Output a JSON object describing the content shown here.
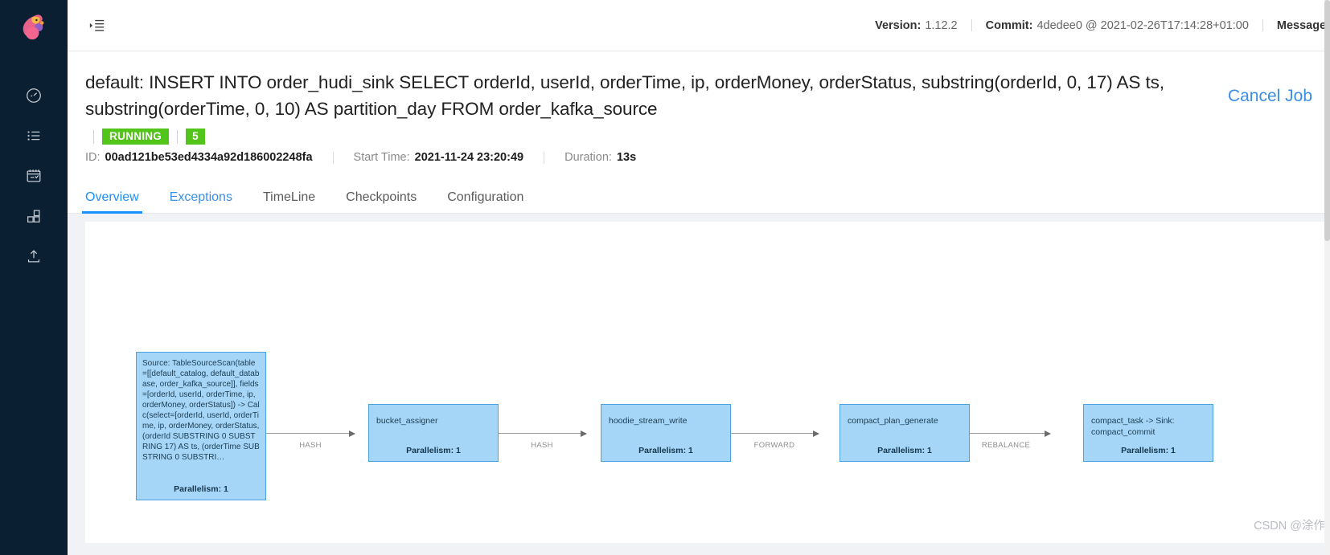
{
  "sidebar": {
    "logo_alt": "apache-flink-squirrel-logo",
    "items": [
      {
        "name": "overview",
        "icon": "dashboard-gauge-icon"
      },
      {
        "name": "jobs",
        "icon": "list-icon"
      },
      {
        "name": "task-managers",
        "icon": "calendar-check-icon"
      },
      {
        "name": "job-manager",
        "icon": "blocks-icon"
      },
      {
        "name": "submit-new-job",
        "icon": "upload-icon"
      }
    ]
  },
  "topbar": {
    "collapse_icon": "menu-collapse-icon",
    "version_label": "Version:",
    "version_value": "1.12.2",
    "commit_label": "Commit:",
    "commit_value": "4dedee0 @ 2021-02-26T17:14:28+01:00",
    "message_label": "Message:"
  },
  "job": {
    "title": "default: INSERT INTO order_hudi_sink SELECT orderId, userId, orderTime, ip, orderMoney, orderStatus, substring(orderId, 0, 17) AS ts, substring(orderTime, 0, 10) AS partition_day FROM order_kafka_source",
    "cancel_label": "Cancel Job",
    "status_badge": "RUNNING",
    "task_count_badge": "5",
    "id_label": "ID:",
    "id_value": "00ad121be53ed4334a92d186002248fa",
    "start_time_label": "Start Time:",
    "start_time_value": "2021-11-24 23:20:49",
    "duration_label": "Duration:",
    "duration_value": "13s",
    "status_color": "#52c41a",
    "accent_color": "#1890ff"
  },
  "tabs": [
    {
      "label": "Overview",
      "active": true,
      "link": false
    },
    {
      "label": "Exceptions",
      "active": false,
      "link": true
    },
    {
      "label": "TimeLine",
      "active": false,
      "link": false
    },
    {
      "label": "Checkpoints",
      "active": false,
      "link": false
    },
    {
      "label": "Configuration",
      "active": false,
      "link": false
    }
  ],
  "graph": {
    "node_fill": "#a5d6f7",
    "node_border": "#4aa3e0",
    "parallelism_label": "Parallelism: 1",
    "nodes": [
      {
        "id": "source",
        "text": "Source: TableSourceScan(table=[[default_catalog, default_database, order_kafka_source]], fields=[orderId, userId, orderTime, ip, orderMoney, orderStatus]) -> Calc(select=[orderId, userId, orderTime, ip, orderMoney, orderStatus, (orderId SUBSTRING 0 SUBSTRING 17) AS ts, (orderTime SUBSTRING 0 SUBSTRI…",
        "parallelism": "Parallelism: 1"
      },
      {
        "id": "bucket_assigner",
        "text": "bucket_assigner",
        "parallelism": "Parallelism: 1"
      },
      {
        "id": "hoodie_stream_write",
        "text": "hoodie_stream_write",
        "parallelism": "Parallelism: 1"
      },
      {
        "id": "compact_plan_generate",
        "text": "compact_plan_generate",
        "parallelism": "Parallelism: 1"
      },
      {
        "id": "compact_task_sink",
        "text": "compact_task -> Sink: compact_commit",
        "parallelism": "Parallelism: 1"
      }
    ],
    "edges": [
      {
        "from": "source",
        "to": "bucket_assigner",
        "label": "HASH"
      },
      {
        "from": "bucket_assigner",
        "to": "hoodie_stream_write",
        "label": "HASH"
      },
      {
        "from": "hoodie_stream_write",
        "to": "compact_plan_generate",
        "label": "FORWARD"
      },
      {
        "from": "compact_plan_generate",
        "to": "compact_task_sink",
        "label": "REBALANCE"
      }
    ]
  },
  "watermark": {
    "text": "CSDN @涂作权的博客"
  }
}
